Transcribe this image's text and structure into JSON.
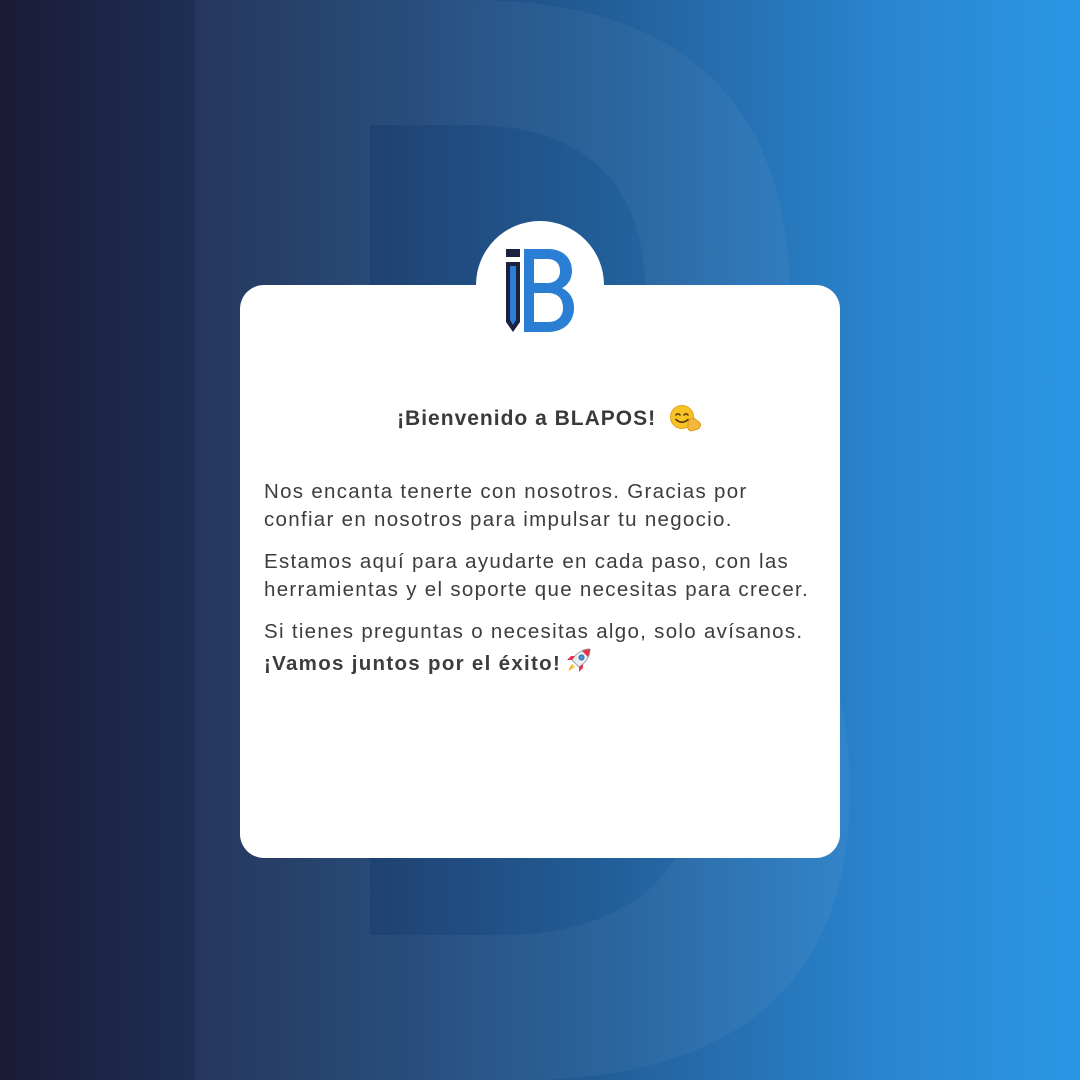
{
  "brand": {
    "name": "BLAPOS",
    "colors": {
      "background_dark": "#1b1b36",
      "background_light": "#2a97e6",
      "card": "#ffffff",
      "text": "#3d3d3d",
      "logo_navy": "#1b2140",
      "logo_blue": "#2a7fd4"
    }
  },
  "card": {
    "title": "¡Bienvenido a BLAPOS!",
    "title_emoji": "smiling-face-emoji",
    "paragraphs": [
      "Nos encanta tenerte con nosotros. Gracias por confiar en nosotros para impulsar tu negocio.",
      "Estamos aquí para ayudarte en cada paso, con las herramientas y el soporte que necesitas para crecer."
    ],
    "closing_text": "Si tienes preguntas o necesitas algo, solo avísanos. ",
    "closing_bold": "¡Vamos juntos por el éxito!",
    "closing_emoji": "rocket-emoji"
  }
}
